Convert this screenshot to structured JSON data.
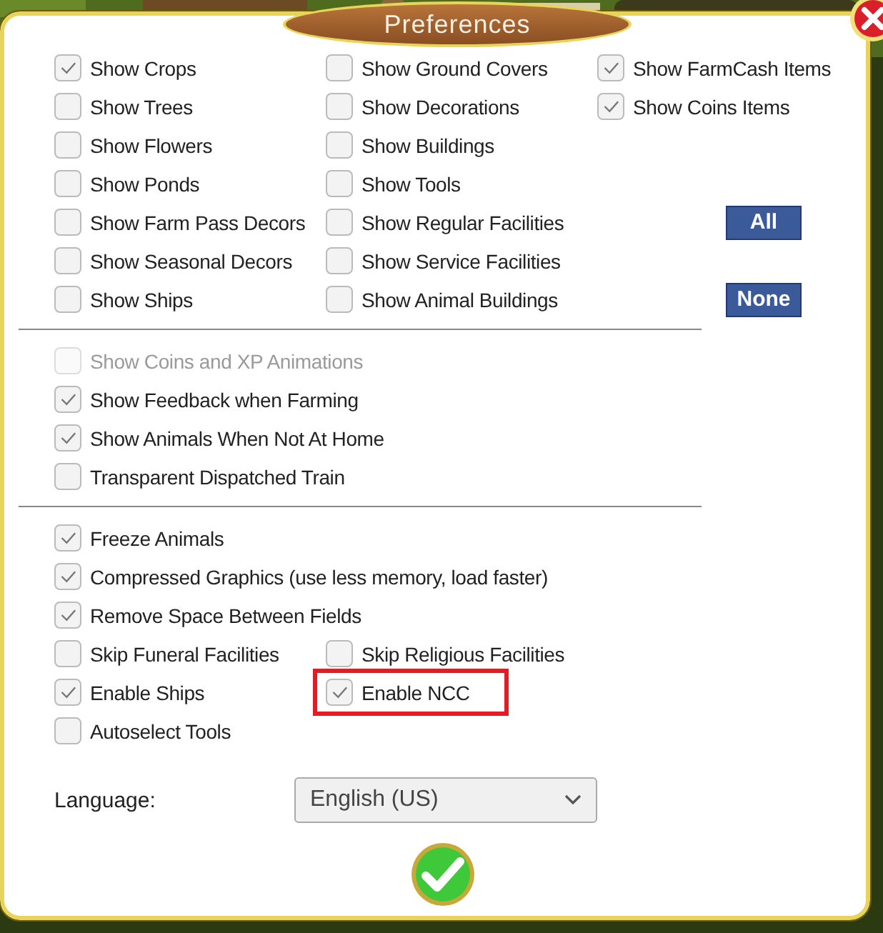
{
  "dialog": {
    "title": "Preferences"
  },
  "display_section": {
    "rows": [
      [
        {
          "label": "Show Crops",
          "checked": true,
          "disabled": false,
          "highlighted": false
        },
        {
          "label": "Show Ground Covers",
          "checked": false,
          "disabled": false,
          "highlighted": false
        },
        {
          "label": "Show FarmCash Items",
          "checked": true,
          "disabled": false,
          "highlighted": false
        }
      ],
      [
        {
          "label": "Show Trees",
          "checked": false,
          "disabled": false,
          "highlighted": false
        },
        {
          "label": "Show Decorations",
          "checked": false,
          "disabled": false,
          "highlighted": false
        },
        {
          "label": "Show Coins Items",
          "checked": true,
          "disabled": false,
          "highlighted": false
        }
      ],
      [
        {
          "label": "Show Flowers",
          "checked": false,
          "disabled": false,
          "highlighted": false
        },
        {
          "label": "Show Buildings",
          "checked": false,
          "disabled": false,
          "highlighted": false
        }
      ],
      [
        {
          "label": "Show Ponds",
          "checked": false,
          "disabled": false,
          "highlighted": false
        },
        {
          "label": "Show Tools",
          "checked": false,
          "disabled": false,
          "highlighted": false
        }
      ],
      [
        {
          "label": "Show Farm Pass Decors",
          "checked": false,
          "disabled": false,
          "highlighted": false
        },
        {
          "label": "Show Regular Facilities",
          "checked": false,
          "disabled": false,
          "highlighted": false
        }
      ],
      [
        {
          "label": "Show Seasonal Decors",
          "checked": false,
          "disabled": false,
          "highlighted": false
        },
        {
          "label": "Show Service Facilities",
          "checked": false,
          "disabled": false,
          "highlighted": false
        }
      ],
      [
        {
          "label": "Show Ships",
          "checked": false,
          "disabled": false,
          "highlighted": false
        },
        {
          "label": "Show Animal Buildings",
          "checked": false,
          "disabled": false,
          "highlighted": false
        }
      ]
    ],
    "buttons": [
      "All",
      "None"
    ]
  },
  "effects_section": {
    "rows": [
      [
        {
          "label": "Show Coins and XP Animations",
          "checked": false,
          "disabled": true,
          "highlighted": false
        }
      ],
      [
        {
          "label": "Show Feedback when Farming",
          "checked": true,
          "disabled": false,
          "highlighted": false
        }
      ],
      [
        {
          "label": "Show Animals When Not At Home",
          "checked": true,
          "disabled": false,
          "highlighted": false
        }
      ],
      [
        {
          "label": "Transparent Dispatched Train",
          "checked": false,
          "disabled": false,
          "highlighted": false
        }
      ]
    ]
  },
  "performance_section": {
    "rows": [
      [
        {
          "label": "Freeze Animals",
          "checked": true,
          "disabled": false,
          "highlighted": false
        }
      ],
      [
        {
          "label": "Compressed Graphics (use less memory, load faster)",
          "checked": true,
          "disabled": false,
          "highlighted": false
        }
      ],
      [
        {
          "label": "Remove Space Between Fields",
          "checked": true,
          "disabled": false,
          "highlighted": false
        }
      ],
      [
        {
          "label": "Skip Funeral Facilities",
          "checked": false,
          "disabled": false,
          "highlighted": false
        },
        {
          "label": "Skip Religious Facilities",
          "checked": false,
          "disabled": false,
          "highlighted": false
        }
      ],
      [
        {
          "label": "Enable Ships",
          "checked": true,
          "disabled": false,
          "highlighted": false
        },
        {
          "label": "Enable NCC",
          "checked": true,
          "disabled": false,
          "highlighted": true
        }
      ],
      [
        {
          "label": "Autoselect Tools",
          "checked": false,
          "disabled": false,
          "highlighted": false
        }
      ]
    ]
  },
  "language": {
    "label": "Language:",
    "value": "English (US)"
  }
}
